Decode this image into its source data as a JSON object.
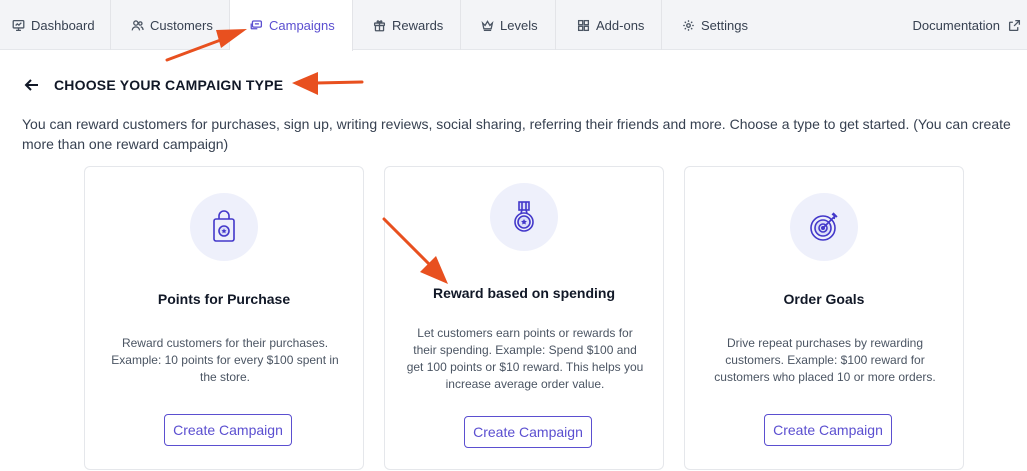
{
  "tabs": [
    {
      "label": "Dashboard",
      "icon": "monitor-icon"
    },
    {
      "label": "Customers",
      "icon": "users-icon"
    },
    {
      "label": "Campaigns",
      "icon": "chat-icon",
      "active": true
    },
    {
      "label": "Rewards",
      "icon": "gift-icon"
    },
    {
      "label": "Levels",
      "icon": "crown-icon"
    },
    {
      "label": "Add-ons",
      "icon": "grid-icon"
    },
    {
      "label": "Settings",
      "icon": "gear-icon"
    }
  ],
  "documentation": {
    "label": "Documentation",
    "icon": "external-link-icon"
  },
  "page": {
    "title": "CHOOSE YOUR CAMPAIGN TYPE",
    "description": "You can reward customers for purchases, sign up, writing reviews, social sharing, referring their friends and more. Choose a type to get started. (You can create more than one reward campaign)"
  },
  "cards": [
    {
      "title": "Points for Purchase",
      "text": "Reward customers for their purchases. Example: 10 points for every $100 spent in the store.",
      "button": "Create Campaign",
      "icon": "shopping-bag-icon"
    },
    {
      "title": "Reward based on spending",
      "text": "Let customers earn points or rewards for their spending. Example: Spend $100 and get 100 points or $10 reward. This helps you increase average order value.",
      "button": "Create Campaign",
      "icon": "medal-icon"
    },
    {
      "title": "Order Goals",
      "text": "Drive repeat purchases by rewarding customers. Example: $100 reward for customers who placed 10 or more orders.",
      "button": "Create Campaign",
      "icon": "target-icon"
    }
  ],
  "colors": {
    "accent": "#5b4fd0",
    "annotation": "#e8501f",
    "icon_bg": "#eef0fb"
  }
}
